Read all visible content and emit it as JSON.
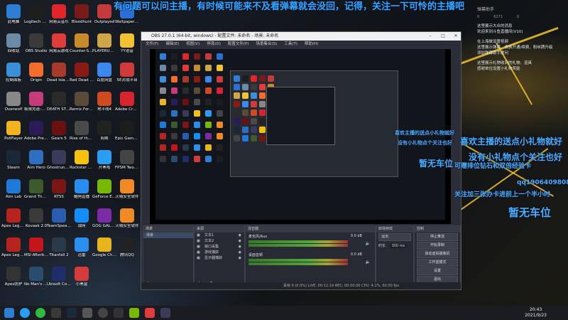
{
  "banner_text": "有问题可以问主播，有时候可能来不及看弹幕就会没回，记得，关注一下可怜的主播吧",
  "desktop_icons": [
    {
      "label": "此电脑",
      "color": "#2d7fd3"
    },
    {
      "label": "Logitech G HUB",
      "color": "#1e1e1e"
    },
    {
      "label": "网易云音乐",
      "color": "#e0262b"
    },
    {
      "label": "Bloodhunt",
      "color": "#7a1b1b"
    },
    {
      "label": "Outplayed",
      "color": "#c53b3b"
    },
    {
      "label": "Wallpaper Engine",
      "color": "#2a6fd6"
    },
    {
      "label": "回收站",
      "color": "#6c8aa6"
    },
    {
      "label": "OBS Studio",
      "color": "#3a3a3a"
    },
    {
      "label": "网易云游戏",
      "color": "#e23b3b"
    },
    {
      "label": "Counter-Strike: Global Off...",
      "color": "#c98b2a"
    },
    {
      "label": "PLAYERUNKNOWN'S BATTLEGR...",
      "color": "#cfa647"
    },
    {
      "label": "YY语音",
      "color": "#f1c232"
    },
    {
      "label": "控制面板",
      "color": "#3a8fd8"
    },
    {
      "label": "Origin",
      "color": "#f56c2d"
    },
    {
      "label": "Dead Island Riptide Def...",
      "color": "#a73a2a"
    },
    {
      "label": "Red Dead Redempti...",
      "color": "#8a1a14"
    },
    {
      "label": "百度网盘",
      "color": "#3d87f0"
    },
    {
      "label": "5E对战平台",
      "color": "#d13a3a"
    },
    {
      "label": "Overwolf",
      "color": "#888"
    },
    {
      "label": "极限竞速:地平线",
      "color": "#c73b7a"
    },
    {
      "label": "DEATH STRANDING",
      "color": "#2a2a2a"
    },
    {
      "label": "Remix Fortune ...",
      "color": "#5a4a3a"
    },
    {
      "label": "地平线4",
      "color": "#d04a1f"
    },
    {
      "label": "Adobe Creati...",
      "color": "#d9232f"
    },
    {
      "label": "PotPlayer",
      "color": "#f2b320"
    },
    {
      "label": "Adobe Premie...",
      "color": "#2b1b57"
    },
    {
      "label": "Gears 5",
      "color": "#6a1010"
    },
    {
      "label": "Rise of the Tomb Rai...",
      "color": "#4a4a4a"
    },
    {
      "label": "剪映",
      "color": "#222"
    },
    {
      "label": "Epic Games Launcher",
      "color": "#1d1d1d"
    },
    {
      "label": "Steam",
      "color": "#1b2838"
    },
    {
      "label": "Aim Hero",
      "color": "#2f6fbf"
    },
    {
      "label": "Ghostrunner",
      "color": "#3a3a5a"
    },
    {
      "label": "Rockstar Games...",
      "color": "#f4c20d"
    },
    {
      "label": "开黑啦",
      "color": "#2a9df4"
    },
    {
      "label": "FPSM TwoTools",
      "color": "#444"
    },
    {
      "label": "Aim Lab",
      "color": "#1f79d9"
    },
    {
      "label": "Grand Theft Auto V",
      "color": "#3d5a2d"
    },
    {
      "label": "RTSS",
      "color": "#7a1515"
    },
    {
      "label": "酷狗直播",
      "color": "#2b8cf0"
    },
    {
      "label": "GeForce Experience",
      "color": "#76b900"
    },
    {
      "label": "火绒安全软件",
      "color": "#f08a24"
    },
    {
      "label": "Apex Legen...",
      "color": "#b7241d"
    },
    {
      "label": "Kovaak 2.0",
      "color": "#3a3a3a"
    },
    {
      "label": "TeamSpeak 3 Client",
      "color": "#2a5db0"
    },
    {
      "label": "战网",
      "color": "#148eff"
    },
    {
      "label": "GOG GALAXY 2.0",
      "color": "#7b2ba6"
    },
    {
      "label": "火绒安全软件",
      "color": "#f08a24"
    },
    {
      "label": "Apex Legends",
      "color": "#b7241d"
    },
    {
      "label": "MSI Afterburner",
      "color": "#c4151c"
    },
    {
      "label": "Titanfall 2",
      "color": "#2a3a4a"
    },
    {
      "label": "迅雷",
      "color": "#2a8ff0"
    },
    {
      "label": "Google Chrome",
      "color": "#e8b41c"
    },
    {
      "label": "腾讯QQ",
      "color": "#222"
    },
    {
      "label": "Apex防护",
      "color": "#333"
    },
    {
      "label": "No Man's Sky",
      "color": "#2a4d6e"
    },
    {
      "label": "Ubisoft Connect",
      "color": "#1f2d6b"
    },
    {
      "label": "小黑盒",
      "color": "#d43b3b"
    }
  ],
  "obs": {
    "title": "OBS 27.0.1 (64-bit, windows) - 配置文件: 未命名 - 场景: 未命名",
    "menu": [
      "文件(F)",
      "编辑(E)",
      "视图(V)",
      "停靠(D)",
      "配置文件(P)",
      "场景集合(S)",
      "工具(T)",
      "帮助(H)"
    ],
    "docks": {
      "scenes_title": "场景",
      "sources_title": "来源",
      "mixer_title": "混音器",
      "transition_title": "转场特效",
      "controls_title": "控制"
    },
    "scene_items": [
      "场景"
    ],
    "source_items": [
      "文本1",
      "文本2",
      "窗口采集",
      "游戏捕获",
      "显示器捕获"
    ],
    "mixer_items": [
      {
        "name": "麦克风/Aux",
        "level": "0.0 dB"
      },
      {
        "name": "桌面音频",
        "level": "0.0 dB"
      }
    ],
    "transition": {
      "type": "淡出",
      "duration_label": "时长",
      "duration": "300 ms"
    },
    "controls": [
      "停止推流",
      "开始录制",
      "启动虚拟摄像机",
      "工作室模式",
      "设置",
      "退出"
    ],
    "status": "丢帧 0 (0.0%)   LIVE: 00:12:19   REC: 00:00:00   CPU: 4.1%, 60.00 fps"
  },
  "chat": {
    "header": "弹幕助手",
    "stats": [
      "0",
      "6271",
      "0"
    ],
    "lines": [
      "这里展示大众的消息",
      "欢迎来到斗鱼直播间(V10)",
      "",
      "在上海做设置视频",
      "这里展示弹幕、贵族开通/续费、粉丝牌升级",
      "添加弹幕助手提问",
      "",
      "这里展示礼物收到的礼物、道具",
      "感谢单位设置小礼物奖励"
    ]
  },
  "danmu": [
    {
      "text": "喜欢主播的送点小礼物就好",
      "size": 12
    },
    {
      "text": "没有小礼物点个关注也好",
      "size": 12
    },
    {
      "text": "可赠排位钻石和双倍经验卡",
      "size": 9
    },
    {
      "text": "qq1906409808",
      "size": 9
    },
    {
      "text": "关注加三张办卡进前上一个半小时",
      "size": 9
    },
    {
      "text": "暂无车位",
      "size": 15
    },
    {
      "text": "暂无车位",
      "size": 12
    },
    {
      "text": "喜欢主播的送点小礼物就好",
      "size": 7
    },
    {
      "text": "没有小礼物点个关注也好",
      "size": 7
    }
  ],
  "clock": {
    "time": "20:43",
    "date": "2021/9/23"
  }
}
